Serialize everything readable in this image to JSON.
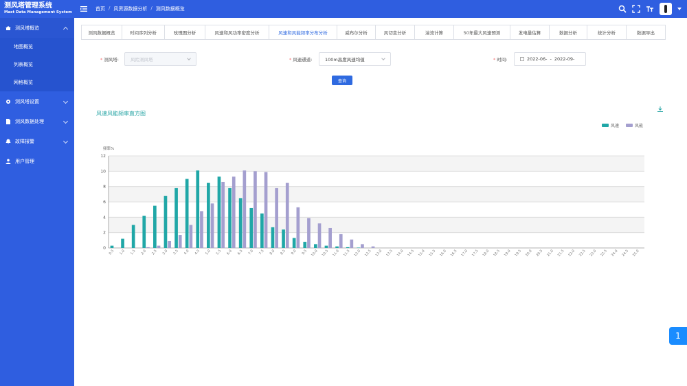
{
  "header": {
    "title": "测风塔管理系统",
    "subtitle": "Mast Data Management System",
    "breadcrumb": [
      "首页",
      "风资源数据分析",
      "测风数据概览"
    ]
  },
  "sidebar": {
    "items": [
      {
        "label": "测风塔概览",
        "icon": "tower-icon",
        "open": true
      },
      {
        "label": "测风塔设置",
        "icon": "gear-icon"
      },
      {
        "label": "测风数据处理",
        "icon": "file-icon"
      },
      {
        "label": "故障报警",
        "icon": "bell-icon"
      },
      {
        "label": "用户管理",
        "icon": "user-icon"
      }
    ],
    "subitems": [
      "地图概览",
      "列表概览",
      "网格概览"
    ]
  },
  "tabs": [
    {
      "label": "测风数据概览"
    },
    {
      "label": "时间序列分析"
    },
    {
      "label": "玫瑰图分析"
    },
    {
      "label": "风速和风功率密度分析"
    },
    {
      "label": "风速和风能频率分布分析",
      "active": true
    },
    {
      "label": "威布尔分析"
    },
    {
      "label": "风切变分析"
    },
    {
      "label": "湍流计算"
    },
    {
      "label": "50年最大风速预测"
    },
    {
      "label": "发电量估算"
    },
    {
      "label": "数据分析"
    },
    {
      "label": "统计分析"
    },
    {
      "label": "数据导出"
    }
  ],
  "filters": {
    "tower_label": "测风塔:",
    "tower_value": "风险测风塔",
    "channel_label": "风速通道:",
    "channel_value": "100m高度风速均值",
    "time_label": "时间:",
    "time_start": "2022-06-",
    "time_sep": "-",
    "time_end": "2022-09-"
  },
  "query_button": "查询",
  "float_badge": "1",
  "colors": {
    "header": "#2f5ee0",
    "speed": "#20a7a7",
    "energy": "#a49fcf"
  },
  "chart_data": {
    "type": "bar",
    "title": "风速风能频率直方图",
    "ylabel": "频率%",
    "ylim": [
      0,
      12
    ],
    "yticks": [
      0,
      2,
      4,
      6,
      8,
      10,
      12
    ],
    "grid": true,
    "legend_position": "top-right",
    "categories": [
      "0.5",
      "1.0",
      "1.5",
      "2.0",
      "2.5",
      "3.0",
      "3.5",
      "4.0",
      "4.5",
      "5.0",
      "5.5",
      "6.0",
      "6.5",
      "7.0",
      "7.5",
      "8.0",
      "8.5",
      "9.0",
      "9.5",
      "10.0",
      "10.5",
      "11.0",
      "11.5",
      "12.0",
      "12.5",
      "13.0",
      "13.5",
      "14.0",
      "14.5",
      "15.0",
      "15.5",
      "16.0",
      "16.5",
      "17.0",
      "17.5",
      "18.0",
      "18.5",
      "19.0",
      "19.5",
      "20.0",
      "20.5",
      "21.0",
      "21.5",
      "22.0",
      "22.5",
      "23.0",
      "23.5",
      "24.0",
      "24.5",
      "25.0"
    ],
    "series": [
      {
        "name": "风速",
        "values": [
          0.3,
          1.2,
          3.0,
          4.2,
          5.5,
          6.8,
          7.8,
          9.0,
          10.1,
          8.5,
          9.3,
          7.8,
          6.5,
          5.2,
          4.5,
          2.7,
          2.4,
          1.3,
          0.8,
          0.5,
          0.3,
          0.2,
          0.1,
          0.05,
          0,
          0,
          0,
          0,
          0,
          0,
          0,
          0,
          0,
          0,
          0,
          0,
          0,
          0,
          0,
          0,
          0,
          0,
          0,
          0,
          0,
          0,
          0,
          0,
          0,
          0
        ]
      },
      {
        "name": "风能",
        "values": [
          0,
          0,
          0,
          0.1,
          0.3,
          0.9,
          1.7,
          3.0,
          4.8,
          5.8,
          8.6,
          9.3,
          10.1,
          10.0,
          9.9,
          7.8,
          8.5,
          5.3,
          3.9,
          3.2,
          2.6,
          1.8,
          1.1,
          0.5,
          0.2,
          0,
          0,
          0,
          0,
          0,
          0,
          0,
          0,
          0,
          0,
          0,
          0,
          0,
          0,
          0,
          0,
          0,
          0,
          0,
          0,
          0,
          0,
          0,
          0,
          0
        ]
      }
    ]
  }
}
